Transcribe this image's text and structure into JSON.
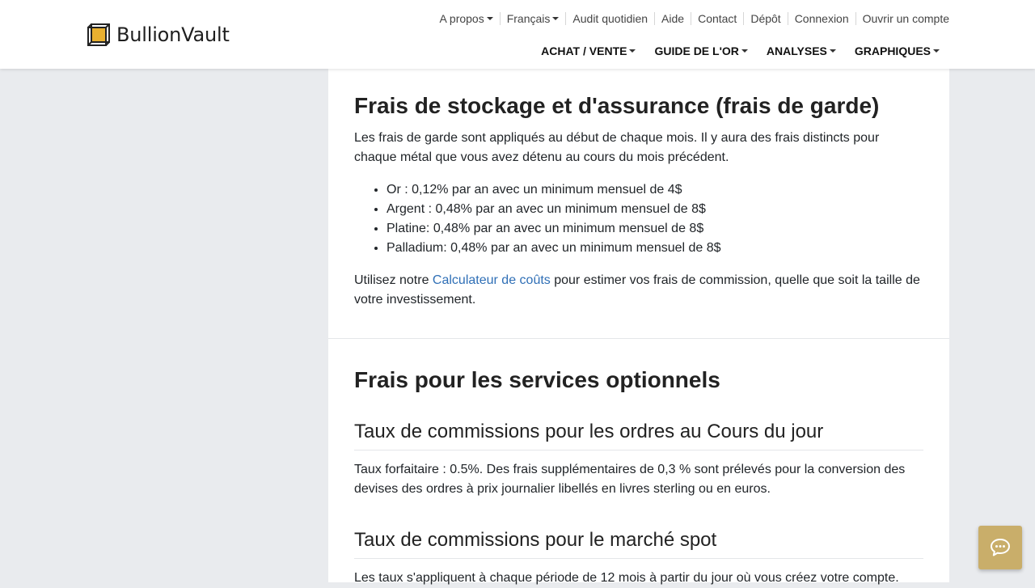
{
  "brand": {
    "name": "BullionVault",
    "accent_color": "#e8b030",
    "chat_color": "#c9ae6a"
  },
  "topnav": [
    {
      "label": "A propos",
      "dropdown": true
    },
    {
      "label": "Français",
      "dropdown": true
    },
    {
      "label": "Audit quotidien",
      "dropdown": false
    },
    {
      "label": "Aide",
      "dropdown": false
    },
    {
      "label": "Contact",
      "dropdown": false
    },
    {
      "label": "Dépôt",
      "dropdown": false
    },
    {
      "label": "Connexion",
      "dropdown": false
    },
    {
      "label": "Ouvrir un compte",
      "dropdown": false
    }
  ],
  "mainnav": [
    {
      "label": "ACHAT / VENTE"
    },
    {
      "label": "GUIDE DE L'OR"
    },
    {
      "label": "ANALYSES"
    },
    {
      "label": "GRAPHIQUES"
    }
  ],
  "storage": {
    "heading": "Frais de stockage et d'assurance (frais de garde)",
    "intro": "Les frais de garde sont appliqués au début de chaque mois. Il y aura des frais distincts pour chaque métal que vous avez détenu au cours du mois précédent.",
    "items": [
      "Or : 0,12% par an avec un minimum mensuel de 4$",
      "Argent : 0,48% par an avec un minimum mensuel de 8$",
      "Platine: 0,48% par an avec un minimum mensuel de 8$",
      "Palladium: 0,48% par an avec un minimum mensuel de 8$"
    ],
    "calc_prefix": "Utilisez notre ",
    "calc_link": "Calculateur de coûts",
    "calc_suffix": " pour estimer vos frais de commission, quelle que soit la taille de votre investissement."
  },
  "optional": {
    "heading": "Frais pour les services optionnels",
    "daily_heading": "Taux de commissions pour les ordres au Cours du jour",
    "daily_text": "Taux forfaitaire : 0.5%. Des frais supplémentaires de 0,3 % sont prélevés pour la conversion des devises des ordres à prix journalier libellés en livres sterling ou en euros.",
    "spot_heading": "Taux de commissions pour le marché spot",
    "spot_text": "Les taux s'appliquent à chaque période de 12 mois à partir du jour où vous créez votre compte."
  },
  "chat": {
    "icon": "chat-bubble-icon"
  }
}
